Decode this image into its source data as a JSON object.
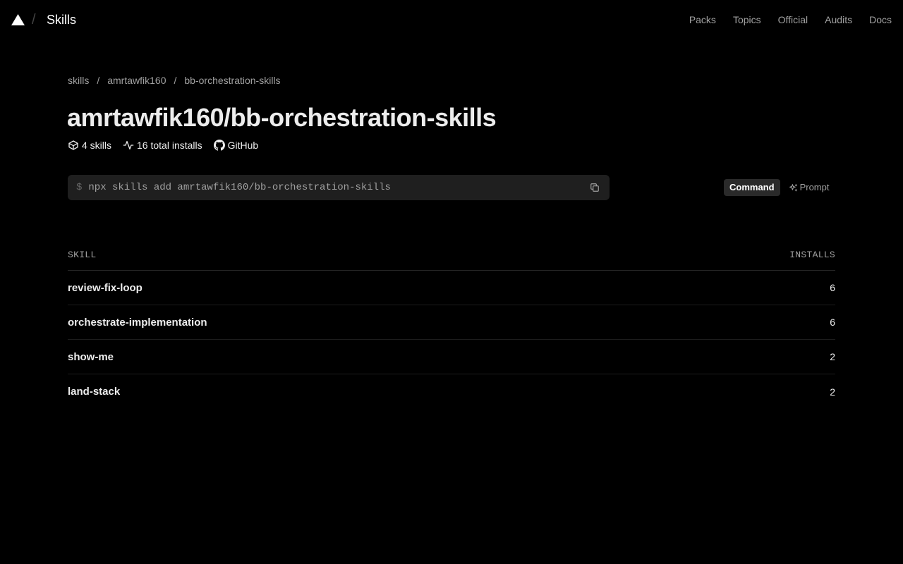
{
  "header": {
    "brand": "Skills",
    "separator": "/",
    "nav": [
      "Packs",
      "Topics",
      "Official",
      "Audits",
      "Docs"
    ]
  },
  "breadcrumb": {
    "items": [
      "skills",
      "amrtawfik160",
      "bb-orchestration-skills"
    ],
    "separator": "/"
  },
  "title": "amrtawfik160/bb-orchestration-skills",
  "meta": {
    "skills": "4 skills",
    "installs": "16 total installs",
    "github": "GitHub"
  },
  "command": {
    "prompt": "$",
    "text": "npx skills add amrtawfik160/bb-orchestration-skills"
  },
  "toggle": {
    "command_label": "Command",
    "prompt_label": "Prompt"
  },
  "table": {
    "columns": [
      "SKILL",
      "INSTALLS"
    ],
    "rows": [
      {
        "name": "review-fix-loop",
        "installs": "6"
      },
      {
        "name": "orchestrate-implementation",
        "installs": "6"
      },
      {
        "name": "show-me",
        "installs": "2"
      },
      {
        "name": "land-stack",
        "installs": "2"
      }
    ]
  },
  "colors": {
    "background": "#000000",
    "text": "#ededed",
    "muted": "#a1a1a1",
    "command_bg": "#1f1f1f"
  },
  "icons": {
    "logo": "triangle-logo-icon",
    "skills": "box-icon",
    "installs": "activity-icon",
    "github": "github-icon",
    "copy": "copy-icon",
    "prompt": "sparkles-icon"
  }
}
